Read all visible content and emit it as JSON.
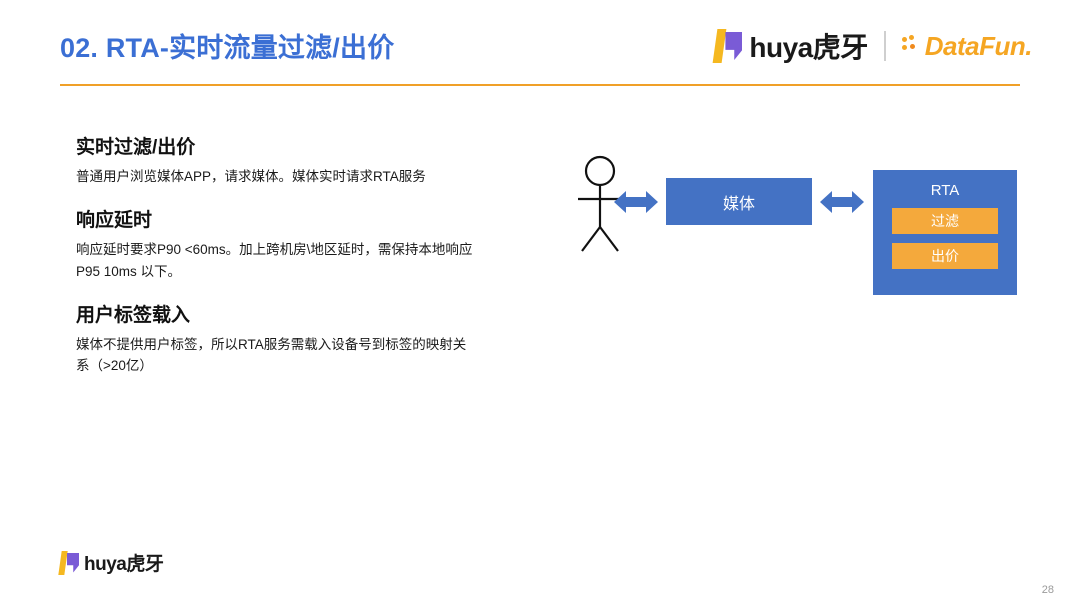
{
  "header": {
    "title": "02. RTA-实时流量过滤/出价",
    "accent_color": "#3b6fd4",
    "rule_color": "#f0a028"
  },
  "brand": {
    "huya_text": "huya虎牙",
    "divider": "|",
    "datafun_text": "DataFun."
  },
  "content": {
    "sections": [
      {
        "title": "实时过滤/出价",
        "body": "普通用户浏览媒体APP，请求媒体。媒体实时请求RTA服务"
      },
      {
        "title": "响应延时",
        "body": "响应延时要求P90 <60ms。加上跨机房\\地区延时，需保持本地响应 P95 10ms 以下。"
      },
      {
        "title": "用户标签载入",
        "body": "媒体不提供用户标签，所以RTA服务需载入设备号到标签的映射关系（>20亿）"
      }
    ]
  },
  "diagram": {
    "media_label": "媒体",
    "rta_label": "RTA",
    "rta_items": [
      "过滤",
      "出价"
    ],
    "box_color": "#4472c4",
    "inner_color": "#f4a93c"
  },
  "footer": {
    "logo_text": "huya虎牙",
    "page_number": "28"
  }
}
